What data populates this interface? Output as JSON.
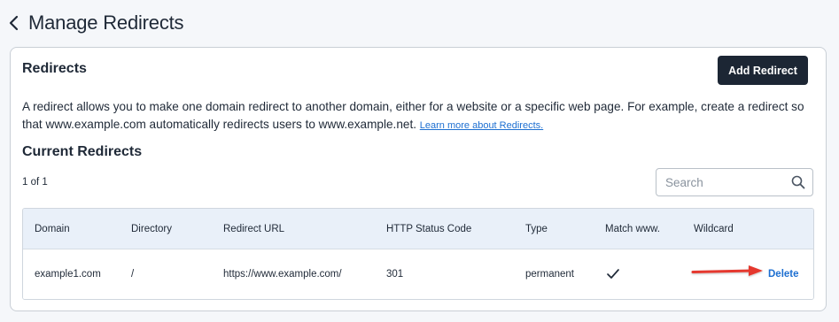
{
  "header": {
    "title": "Manage Redirects",
    "back_icon": "chevron-left-icon"
  },
  "card": {
    "title": "Redirects",
    "add_button": "Add Redirect",
    "description": "A redirect allows you to make one domain redirect to another domain, either for a website or a specific web page. For example, create a redirect so that www.example.com automatically redirects users to www.example.net. ",
    "learn_more": "Learn more about Redirects."
  },
  "current": {
    "title": "Current Redirects",
    "count": "1 of 1",
    "search_placeholder": "Search",
    "search_icon": "search-icon"
  },
  "table": {
    "headers": {
      "domain": "Domain",
      "directory": "Directory",
      "redirect_url": "Redirect URL",
      "status_code": "HTTP Status Code",
      "type": "Type",
      "match_www": "Match www.",
      "wildcard": "Wildcard"
    },
    "rows": [
      {
        "domain": "example1.com",
        "directory": "/",
        "redirect_url": "https://www.example.com/",
        "status_code": "301",
        "type": "permanent",
        "match_www": "checkmark-icon",
        "wildcard": "",
        "action": "Delete"
      }
    ]
  },
  "annotation": {
    "arrow_color": "#e5392f",
    "icon": "red-arrow-annotation"
  },
  "colors": {
    "primary_button": "#1c2634",
    "link": "#1d6fd1",
    "table_header": "#e9f0f9",
    "page_bg": "#f5f7fa"
  }
}
